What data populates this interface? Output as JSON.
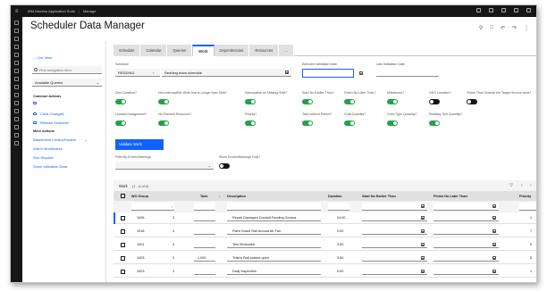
{
  "topbar": {
    "app_title": "IBM Maximo Application Suite",
    "app_name": "Manage"
  },
  "page": {
    "title": "Scheduler Data Manager"
  },
  "left_panel": {
    "back_label": "List View",
    "search_placeholder": "Find navigation item",
    "queries_select": "Available Queries",
    "common_actions_title": "Common Actions",
    "actions": [
      "Clear Changes",
      "Refresh Schedule"
    ],
    "more_actions_title": "More Actions",
    "links": [
      "Attachment Library/Folders",
      "Add to Bookmarks",
      "Run Reports",
      "Show Validation Data"
    ]
  },
  "tabs": [
    "Schedule",
    "Calendar",
    "Queries",
    "Work",
    "Dependencies",
    "Resources",
    "..."
  ],
  "active_tab": "Work",
  "form": {
    "schedule_label": "Schedule",
    "schedule_value": "REDDING",
    "schedule_desc": "Redding team schedule",
    "selected_validation_label": "Selected Validation Date",
    "last_validation_label": "Last Validation Date",
    "toggles": [
      {
        "label": "Zero Duration?",
        "on": true
      },
      {
        "label": "Non-interruptible Work that is Longer than Shift?",
        "on": true
      },
      {
        "label": "Interruptible on Missing Shift?",
        "on": true
      },
      {
        "label": "Start No Earlier Than?",
        "on": true
      },
      {
        "label": "Finish No Later Than?",
        "on": true
      },
      {
        "label": "Milestones?",
        "on": true
      },
      {
        "label": "GEO Location?",
        "on": false
      },
      {
        "label": "Travel Time Outside the Target Service Area?",
        "on": false
      },
      {
        "label": "Location Assignment?",
        "on": true
      },
      {
        "label": "No Planned Resource?",
        "on": true
      },
      {
        "label": "Priority?",
        "on": true
      },
      {
        "label": "Task without Parent?",
        "on": true
      },
      {
        "label": "Craft Quantity?",
        "on": true
      },
      {
        "label": "Crew Type Quantity?",
        "on": true
      },
      {
        "label": "Rotating Tool Quantity?",
        "on": true
      }
    ],
    "validate_button": "Validate Work",
    "filter_label": "Filter By Errors/Warnings",
    "show_errors_label": "Show Errors/Warnings Only?",
    "show_errors_on": false
  },
  "table": {
    "title": "Work",
    "count": "(1 - 6 of 6)",
    "columns": [
      "WO Group",
      "Task",
      "Description",
      "Duration",
      "Start No Earlier Than",
      "Finish No Later Than",
      "Priority"
    ],
    "rows": [
      {
        "wo_group": "1006",
        "wo": "3",
        "task": "",
        "desc": "Repair Damaged Conduit Feeding Genera",
        "duration": "24:00",
        "priority": "1"
      },
      {
        "wo_group": "1018",
        "wo": "3",
        "task": "",
        "desc": "Paint Guard Rail Around Air Fan",
        "duration": "2:00",
        "priority": "7"
      },
      {
        "wo_group": "1001",
        "wo": "3",
        "task": "",
        "desc": "Test Workorder",
        "duration": "3:00",
        "priority": "5"
      },
      {
        "wo_group": "1003",
        "wo": "3",
        "task": "1,000",
        "desc": "Train's Bolt carried open",
        "duration": "3:00",
        "priority": "5"
      },
      {
        "wo_group": "1023",
        "wo": "3",
        "task": "",
        "desc": "Daily Inspection",
        "duration": "0:00",
        "priority": "1"
      }
    ]
  },
  "colors": {
    "primary": "#0f62fe",
    "toggle_on": "#24a148",
    "shell": "#161616"
  }
}
